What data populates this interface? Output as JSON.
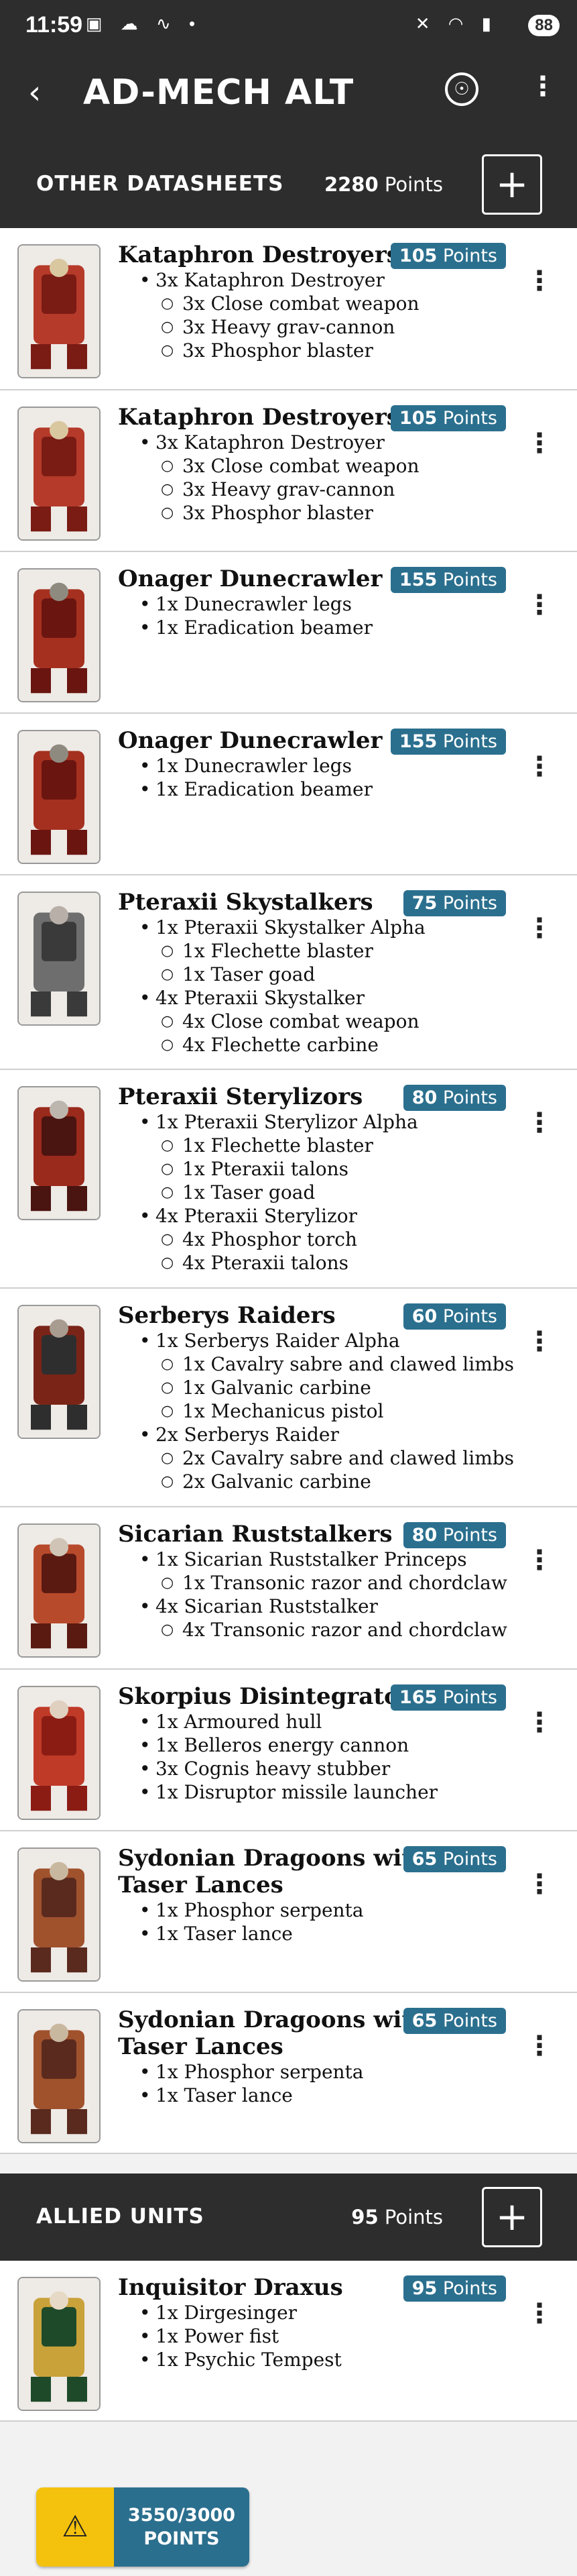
{
  "status": {
    "time": "11:59",
    "battery": "88"
  },
  "app": {
    "title": "AD-MECH ALT"
  },
  "sections": {
    "other": {
      "title": "OTHER DATASHEETS",
      "points_value": "2280",
      "points_label": "Points"
    },
    "allied": {
      "title": "ALLIED UNITS",
      "points_value": "95",
      "points_label": "Points"
    }
  },
  "points_label": "Points",
  "units": [
    {
      "name": "Kataphron Destroyers",
      "points": "105",
      "lines": [
        {
          "t": "3x Kataphron Destroyer"
        },
        {
          "t": "3x Close combat weapon",
          "sub": true
        },
        {
          "t": "3x Heavy grav-cannon",
          "sub": true
        },
        {
          "t": "3x Phosphor blaster",
          "sub": true
        }
      ]
    },
    {
      "name": "Kataphron Destroyers",
      "points": "105",
      "lines": [
        {
          "t": "3x Kataphron Destroyer"
        },
        {
          "t": "3x Close combat weapon",
          "sub": true
        },
        {
          "t": "3x Heavy grav-cannon",
          "sub": true
        },
        {
          "t": "3x Phosphor blaster",
          "sub": true
        }
      ]
    },
    {
      "name": "Onager Dunecrawler",
      "points": "155",
      "lines": [
        {
          "t": "1x Dunecrawler legs"
        },
        {
          "t": "1x Eradication beamer"
        }
      ]
    },
    {
      "name": "Onager Dunecrawler",
      "points": "155",
      "lines": [
        {
          "t": "1x Dunecrawler legs"
        },
        {
          "t": "1x Eradication beamer"
        }
      ]
    },
    {
      "name": "Pteraxii Skystalkers",
      "points": "75",
      "lines": [
        {
          "t": "1x Pteraxii Skystalker Alpha"
        },
        {
          "t": "1x Flechette blaster",
          "sub": true
        },
        {
          "t": "1x Taser goad",
          "sub": true
        },
        {
          "t": "4x Pteraxii Skystalker"
        },
        {
          "t": "4x Close combat weapon",
          "sub": true
        },
        {
          "t": "4x Flechette carbine",
          "sub": true
        }
      ]
    },
    {
      "name": "Pteraxii Sterylizors",
      "points": "80",
      "lines": [
        {
          "t": "1x Pteraxii Sterylizor Alpha"
        },
        {
          "t": "1x Flechette blaster",
          "sub": true
        },
        {
          "t": "1x Pteraxii talons",
          "sub": true
        },
        {
          "t": "1x Taser goad",
          "sub": true
        },
        {
          "t": "4x Pteraxii Sterylizor"
        },
        {
          "t": "4x Phosphor torch",
          "sub": true
        },
        {
          "t": "4x Pteraxii talons",
          "sub": true
        }
      ]
    },
    {
      "name": "Serberys Raiders",
      "points": "60",
      "lines": [
        {
          "t": "1x Serberys Raider Alpha"
        },
        {
          "t": "1x Cavalry sabre and clawed limbs",
          "sub": true
        },
        {
          "t": "1x Galvanic carbine",
          "sub": true
        },
        {
          "t": "1x Mechanicus pistol",
          "sub": true
        },
        {
          "t": "2x Serberys Raider"
        },
        {
          "t": "2x Cavalry sabre and clawed limbs",
          "sub": true
        },
        {
          "t": "2x Galvanic carbine",
          "sub": true
        }
      ]
    },
    {
      "name": "Sicarian Ruststalkers",
      "points": "80",
      "lines": [
        {
          "t": "1x Sicarian Ruststalker Princeps"
        },
        {
          "t": "1x Transonic razor and chordclaw",
          "sub": true
        },
        {
          "t": "4x Sicarian Ruststalker"
        },
        {
          "t": "4x Transonic razor and chordclaw",
          "sub": true
        }
      ]
    },
    {
      "name": "Skorpius Disintegrator",
      "points": "165",
      "lines": [
        {
          "t": "1x Armoured hull"
        },
        {
          "t": "1x Belleros energy cannon"
        },
        {
          "t": "3x Cognis heavy stubber"
        },
        {
          "t": "1x Disruptor missile launcher"
        }
      ]
    },
    {
      "name": "Sydonian Dragoons with Taser Lances",
      "name_line1": "Sydonian Dragoons with",
      "name_line2": "Taser Lances",
      "points": "65",
      "lines": [
        {
          "t": "1x Phosphor serpenta"
        },
        {
          "t": "1x Taser lance"
        }
      ]
    },
    {
      "name": "Sydonian Dragoons with Taser Lances",
      "name_line1": "Sydonian Dragoons with",
      "name_line2": "Taser Lances",
      "points": "65",
      "lines": [
        {
          "t": "1x Phosphor serpenta"
        },
        {
          "t": "1x Taser lance"
        }
      ]
    }
  ],
  "allied_units": [
    {
      "name": "Inquisitor Draxus",
      "points": "95",
      "lines": [
        {
          "t": "1x Dirgesinger"
        },
        {
          "t": "1x Power fist"
        },
        {
          "t": "1x Psychic Tempest"
        }
      ]
    }
  ],
  "fab": {
    "total": "3550/3000",
    "label": "POINTS"
  },
  "colors": {
    "header": "#2d2d2d",
    "badge": "#2b6f8e",
    "warning": "#f4c20d"
  }
}
